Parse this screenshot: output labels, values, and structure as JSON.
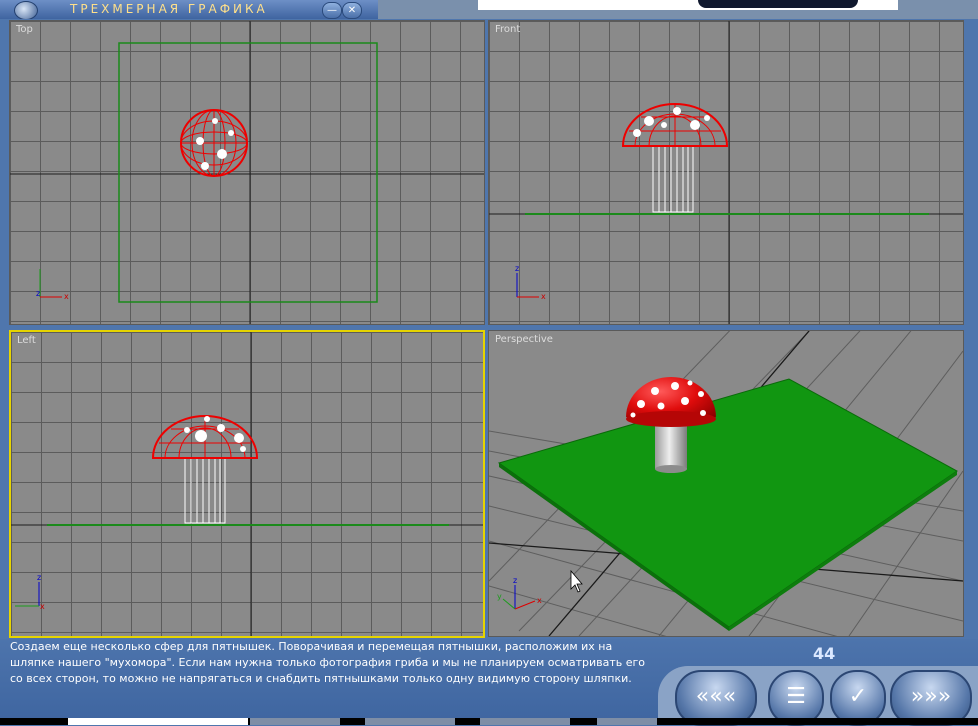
{
  "window": {
    "title": "ТРЕХМЕРНАЯ ГРАФИКА",
    "minimize_label": "—",
    "close_label": "✕"
  },
  "viewports": {
    "top": {
      "label": "Top"
    },
    "front": {
      "label": "Front"
    },
    "left": {
      "label": "Left"
    },
    "perspective": {
      "label": "Perspective"
    }
  },
  "axes": {
    "x": "x",
    "y": "y",
    "z": "z"
  },
  "description": "Создаем еще несколько сфер для пятнышек. Поворачивая и перемещая пятнышки, расположим их на шляпке нашего \"мухомора\". Если нам нужна только фотография гриба и мы не планируем осматривать его со всех сторон, то можно не напрягаться и снабдить пятнышками только одну видимую сторону шляпки.",
  "page_number": "44",
  "nav": {
    "back_label": "«««",
    "menu_label": "☰",
    "check_label": "✓",
    "forward_label": "»»»"
  },
  "colors": {
    "viewport_bg": "#8a8a8a",
    "active_border": "#e6d400",
    "mushroom_cap": "#e01010",
    "ground": "#109410"
  }
}
